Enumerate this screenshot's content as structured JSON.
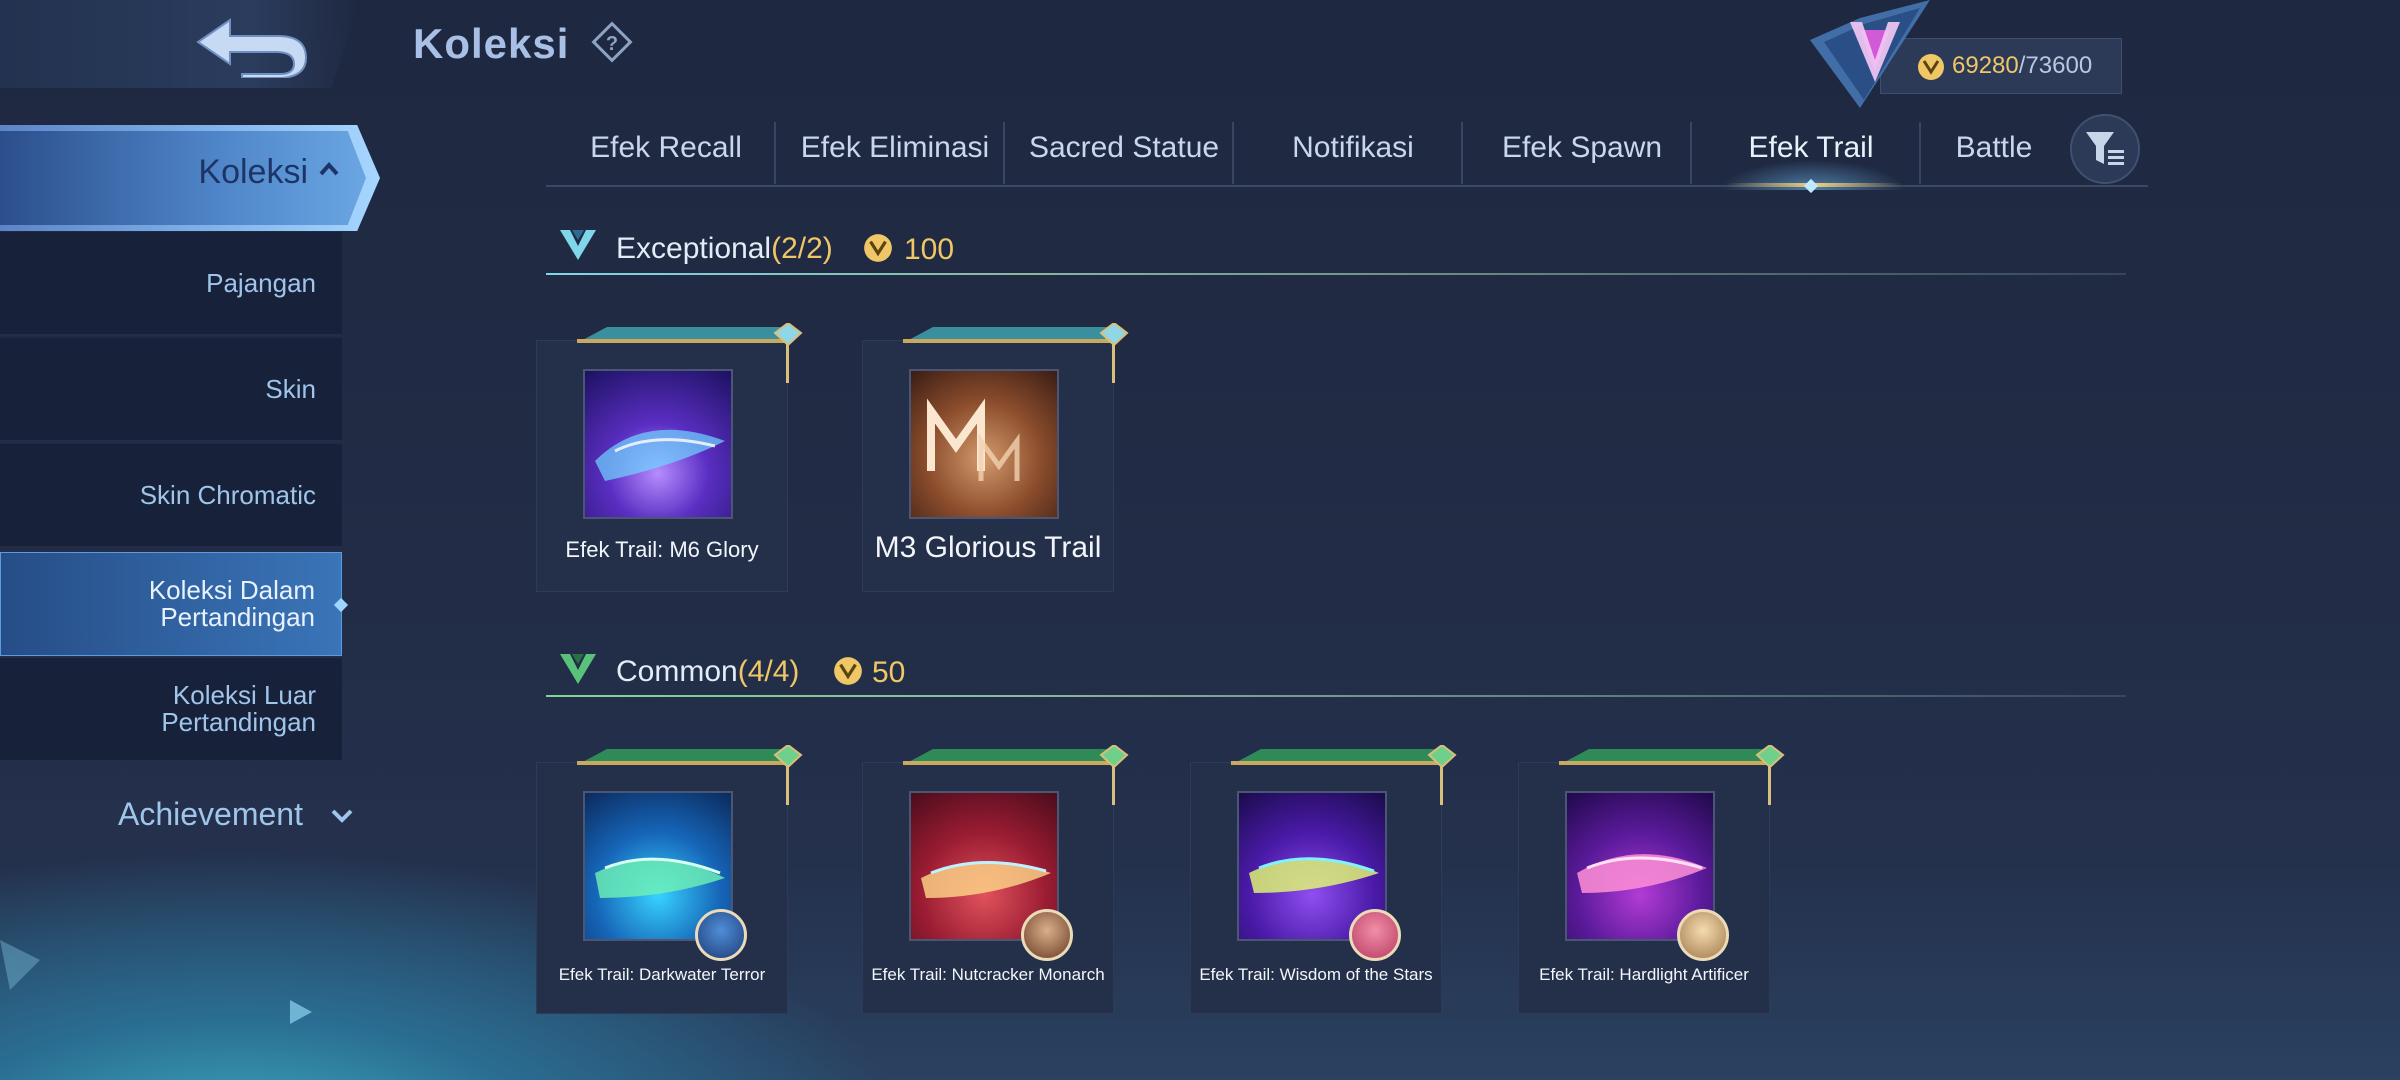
{
  "header": {
    "title": "Koleksi",
    "currency_current": "69280",
    "currency_sep": "/",
    "currency_max": "73600"
  },
  "sidebar": {
    "main": "Koleksi",
    "items": [
      {
        "label": "Pajangan"
      },
      {
        "label": "Skin"
      },
      {
        "label": "Skin Chromatic"
      },
      {
        "label": "Koleksi Dalam Pertandingan"
      },
      {
        "label": "Koleksi Luar Pertandingan"
      }
    ],
    "active_index": 3,
    "achievement": "Achievement"
  },
  "tabs": {
    "items": [
      {
        "label": "Efek Recall"
      },
      {
        "label": "Efek Eliminasi"
      },
      {
        "label": "Sacred Statue"
      },
      {
        "label": "Notifikasi"
      },
      {
        "label": "Efek Spawn"
      },
      {
        "label": "Efek Trail"
      },
      {
        "label": "Battle"
      }
    ],
    "active": "Efek Trail"
  },
  "sections": {
    "exceptional": {
      "title": "Exceptional",
      "count": "(2/2)",
      "points": "100",
      "items": [
        {
          "label": "Efek Trail: M6 Glory"
        },
        {
          "label": "M3 Glorious Trail"
        }
      ]
    },
    "common": {
      "title": "Common",
      "count": "(4/4)",
      "points": "50",
      "items": [
        {
          "label": "Efek Trail: Darkwater Terror"
        },
        {
          "label": "Efek Trail: Nutcracker Monarch"
        },
        {
          "label": "Efek Trail: Wisdom of the Stars"
        },
        {
          "label": "Efek Trail: Hardlight Artificer"
        }
      ]
    }
  },
  "colors": {
    "accent_gold": "#f0c766",
    "sidebar_active": "#3a75b8",
    "text_blue": "#9fc6ea"
  }
}
